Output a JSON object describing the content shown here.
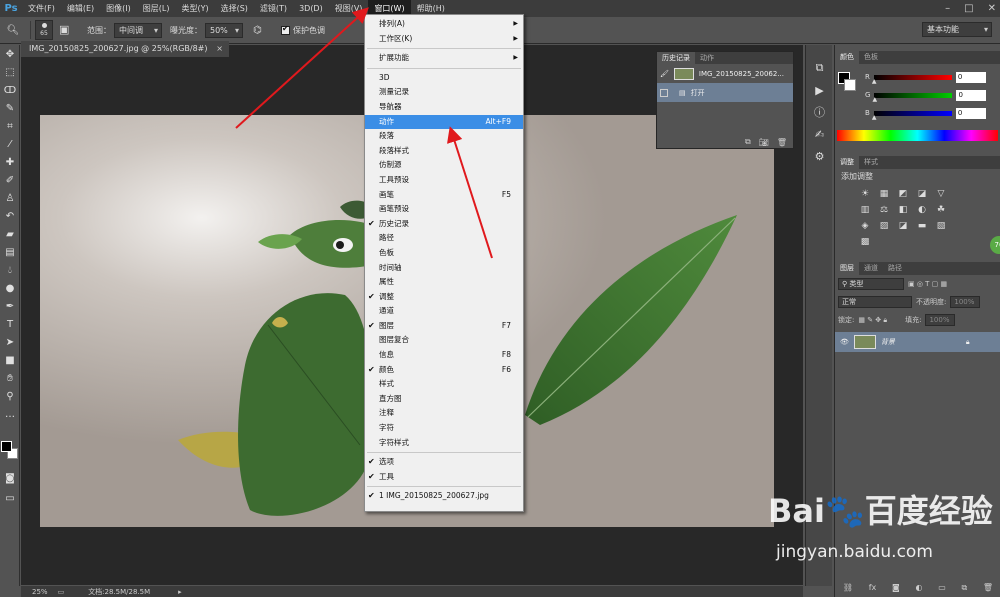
{
  "app": {
    "logo": "Ps"
  },
  "menubar": {
    "items": [
      "文件(F)",
      "编辑(E)",
      "图像(I)",
      "图层(L)",
      "类型(Y)",
      "选择(S)",
      "滤镜(T)",
      "3D(D)",
      "视图(V)",
      "窗口(W)",
      "帮助(H)"
    ],
    "active_index": 9,
    "window_controls": [
      "–",
      "□",
      "✕"
    ]
  },
  "options_bar": {
    "brush_size": "65",
    "range_label": "范围：",
    "range_value": "中间调",
    "exposure_label": "曝光度：",
    "exposure_value": "50%",
    "protect_tones_label": "保护色调",
    "workspace": "基本功能"
  },
  "document": {
    "tab_title": "IMG_20150825_200627.jpg @ 25%(RGB/8#)",
    "tab_close": "×",
    "zoom": "25%",
    "doc_info": "文档:28.5M/28.5M"
  },
  "window_menu": {
    "items": [
      {
        "label": "排列(A)",
        "submenu": true
      },
      {
        "label": "工作区(K)",
        "submenu": true
      },
      {
        "sep": true
      },
      {
        "label": "扩展功能",
        "submenu": true
      },
      {
        "sep": true
      },
      {
        "label": "3D"
      },
      {
        "label": "测量记录"
      },
      {
        "label": "导航器"
      },
      {
        "label": "动作",
        "shortcut": "Alt+F9",
        "highlighted": true
      },
      {
        "label": "段落"
      },
      {
        "label": "段落样式"
      },
      {
        "label": "仿制源"
      },
      {
        "label": "工具预设"
      },
      {
        "label": "画笔",
        "shortcut": "F5"
      },
      {
        "label": "画笔预设"
      },
      {
        "label": "历史记录",
        "checked": true
      },
      {
        "label": "路径"
      },
      {
        "label": "色板"
      },
      {
        "label": "时间轴"
      },
      {
        "label": "属性"
      },
      {
        "label": "调整",
        "checked": true
      },
      {
        "label": "通道"
      },
      {
        "label": "图层",
        "shortcut": "F7",
        "checked": true
      },
      {
        "label": "图层复合"
      },
      {
        "label": "信息",
        "shortcut": "F8"
      },
      {
        "label": "颜色",
        "shortcut": "F6",
        "checked": true
      },
      {
        "label": "样式"
      },
      {
        "label": "直方图"
      },
      {
        "label": "注释"
      },
      {
        "label": "字符"
      },
      {
        "label": "字符样式"
      },
      {
        "sep": true
      },
      {
        "label": "选项",
        "checked": true
      },
      {
        "label": "工具",
        "checked": true
      },
      {
        "sep": true
      },
      {
        "label": "1 IMG_20150825_200627.jpg",
        "checked": true
      }
    ]
  },
  "history_panel": {
    "tabs": [
      "历史记录",
      "动作"
    ],
    "snapshot": "IMG_20150825_20062...",
    "state": "打开"
  },
  "color_panel": {
    "tabs": [
      "颜色",
      "色板"
    ],
    "channels": [
      {
        "label": "R",
        "value": "0",
        "color": "#ff0000"
      },
      {
        "label": "G",
        "value": "0",
        "color": "#00c000"
      },
      {
        "label": "B",
        "value": "0",
        "color": "#0000ff"
      }
    ]
  },
  "adjustments_panel": {
    "tabs": [
      "调整",
      "样式"
    ],
    "title": "添加调整",
    "icons": [
      "☀",
      "▦",
      "◩",
      "◪",
      "▽",
      "▥",
      "⚖",
      "◧",
      "◐",
      "☘",
      "◈",
      "▨",
      "◪",
      "▬",
      "▧",
      "▩"
    ]
  },
  "layers_panel": {
    "tabs": [
      "图层",
      "通道",
      "路径"
    ],
    "filter": "类型",
    "blend_mode": "正常",
    "opacity_label": "不透明度:",
    "opacity_value": "100%",
    "lock_label": "锁定:",
    "fill_label": "填充:",
    "fill_value": "100%",
    "layer_name": "背景",
    "badge": "76"
  },
  "watermark": {
    "logo": "Bai🐾百度经验",
    "url": "jingyan.baidu.com"
  },
  "colors": {
    "highlight": "#3b8ee6",
    "arrow": "#e0191d"
  }
}
